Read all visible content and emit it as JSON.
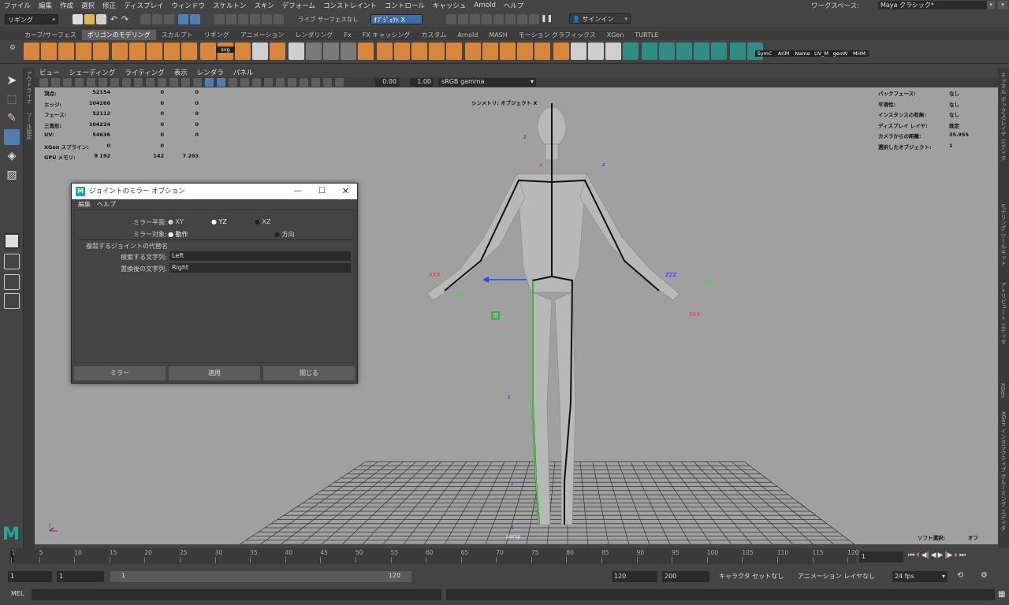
{
  "menubar": {
    "items": [
      "ファイル",
      "編集",
      "作成",
      "選択",
      "修正",
      "ディスプレイ",
      "ウィンドウ",
      "スケルトン",
      "スキン",
      "デフォーム",
      "コンストレイント",
      "コントロール",
      "キャッシュ",
      "Arnold",
      "ヘルプ"
    ],
    "workspace_label": "ワークスペース:",
    "workspace_value": "Maya クラシック*"
  },
  "statusline": {
    "mode_value": "リギング",
    "live_surface": "ライブ サーフェスなし",
    "symmetry_value": "ｵﾌﾞｼﾞｪｸﾄ X",
    "signin_label": "サインイン"
  },
  "shelf": {
    "tabs": [
      "カーブ/サーフェス",
      "ポリゴンのモデリング",
      "スカルプト",
      "リギング",
      "アニメーション",
      "レンダリング",
      "Fx",
      "FX キャッシング",
      "カスタム",
      "Arnold",
      "MASH",
      "モーション グラフィックス",
      "XGen",
      "TURTLE"
    ],
    "active_tab_index": 1,
    "labels": [
      "SymC",
      "AriM",
      "Name",
      "UV_M",
      "geoW",
      "MHM"
    ],
    "svg_label": "svg"
  },
  "left_vtabs": [
    "アウトライナ",
    "ツール設定"
  ],
  "right_vtabs": [
    "チャネル ボックス/レイヤ エディタ",
    "モデリング ツールキット",
    "アトリビュート エディタ",
    "XGen",
    "XGen インタラクティブ グルーミング エディタ"
  ],
  "panel_menu": [
    "ビュー",
    "シェーディング",
    "ライティング",
    "表示",
    "レンダラ",
    "パネル"
  ],
  "panel_toolbar": {
    "exposure": "0.00",
    "gamma": "1.00",
    "colorspace": "sRGB gamma"
  },
  "hud_left": {
    "rows": [
      {
        "label": "頂点:",
        "v1": "52154",
        "v2": "0",
        "v3": "0"
      },
      {
        "label": "エッジ:",
        "v1": "104266",
        "v2": "0",
        "v3": "0"
      },
      {
        "label": "フェース:",
        "v1": "52112",
        "v2": "0",
        "v3": "0"
      },
      {
        "label": "三角形:",
        "v1": "104224",
        "v2": "0",
        "v3": "0"
      },
      {
        "label": "UV:",
        "v1": "54636",
        "v2": "0",
        "v3": "0"
      },
      {
        "label": "XGen スプライン:",
        "v1": "0",
        "v2": "0",
        "v3": ""
      },
      {
        "label": "GPU メモリ:",
        "v1": "8 192",
        "v2": "142",
        "v3": "7 203"
      }
    ]
  },
  "hud_right": {
    "rows": [
      {
        "label": "バックフェース:",
        "value": "なし"
      },
      {
        "label": "平滑性:",
        "value": "なし"
      },
      {
        "label": "インスタンスの有無:",
        "value": "なし"
      },
      {
        "label": "ディスプレイ レイヤ:",
        "value": "既定"
      },
      {
        "label": "カメラからの距離:",
        "value": "35.955"
      },
      {
        "label": "選択したオブジェクト:",
        "value": "1"
      }
    ]
  },
  "hud_symmetry": "シンメトリ: オブジェクト X",
  "hud_camera": "persp",
  "hud_soft_select_label": "ソフト選択:",
  "hud_soft_select_value": "オフ",
  "dialog": {
    "title": "ジョイントのミラー オプション",
    "menu": [
      "編集",
      "ヘルプ"
    ],
    "mirror_plane_label": "ミラー平面:",
    "plane_options": [
      "XY",
      "YZ",
      "XZ"
    ],
    "plane_selected": "YZ",
    "mirror_function_label": "ミラー対象:",
    "function_options": [
      "動作",
      "方向"
    ],
    "function_selected": "動作",
    "section_title": "複製するジョイントの代替名",
    "search_label": "検索する文字列:",
    "search_value": "Left",
    "replace_label": "置換後の文字列:",
    "replace_value": "Right",
    "buttons": [
      "ミラー",
      "適用",
      "閉じる"
    ]
  },
  "timeslider": {
    "ticks": [
      "1",
      "5",
      "10",
      "15",
      "20",
      "25",
      "30",
      "35",
      "40",
      "45",
      "50",
      "55",
      "60",
      "65",
      "70",
      "75",
      "80",
      "85",
      "90",
      "95",
      "100",
      "105",
      "110",
      "115",
      "120"
    ],
    "current_frame": "1"
  },
  "rangeslider": {
    "start": "1",
    "playback_start": "1",
    "range_start_label": "1",
    "range_end_label": "120",
    "playback_end": "120",
    "end": "200",
    "character_set": "キャラクタ セットなし",
    "anim_layer": "アニメーション レイヤなし",
    "fps": "24 fps"
  },
  "cmdline": {
    "label": "MEL"
  },
  "colors": {
    "accent": "#4f7fb0",
    "shelf_orange": "#d8873a",
    "viewport_bg": "#a0a0a0",
    "maya_logo": "#1fa8a1"
  }
}
